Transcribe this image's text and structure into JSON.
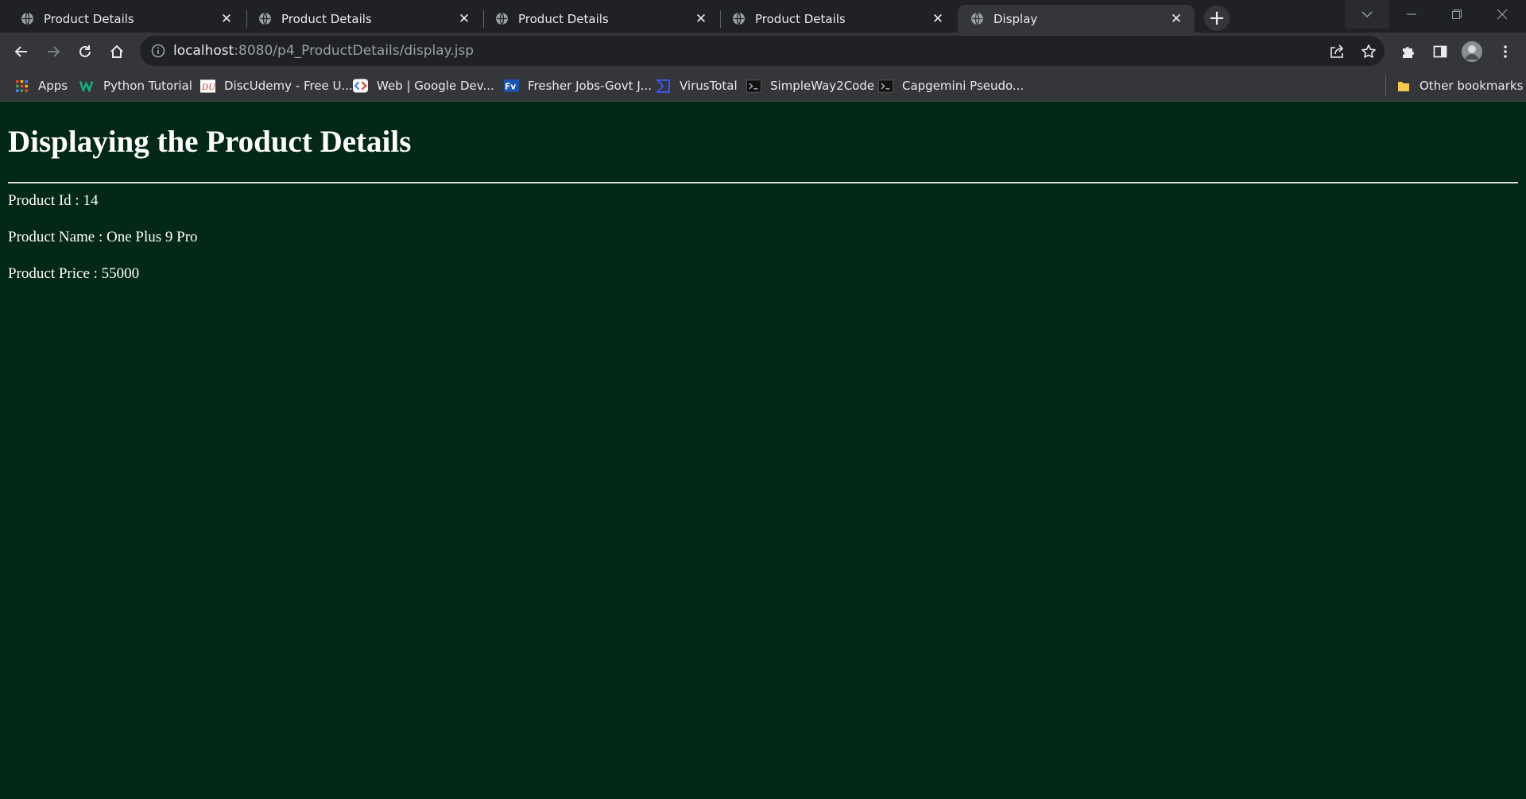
{
  "browser": {
    "tabs": [
      {
        "title": "Product Details"
      },
      {
        "title": "Product Details"
      },
      {
        "title": "Product Details"
      },
      {
        "title": "Product Details"
      },
      {
        "title": "Display",
        "active": true
      }
    ],
    "address": {
      "host": "localhost",
      "rest": ":8080/p4_ProductDetails/display.jsp"
    },
    "bookmarks": [
      {
        "label": "Apps",
        "icon": "apps-grid-icon"
      },
      {
        "label": "Python Tutorial",
        "icon": "w-logo-icon"
      },
      {
        "label": "DiscUdemy - Free U...",
        "icon": "discudemy-icon"
      },
      {
        "label": "Web  |  Google Dev...",
        "icon": "google-developers-icon"
      },
      {
        "label": "Fresher Jobs-Govt J...",
        "icon": "fv-logo-icon"
      },
      {
        "label": "VirusTotal",
        "icon": "virustotal-icon"
      },
      {
        "label": "SimpleWay2Code",
        "icon": "terminal-icon"
      },
      {
        "label": "Capgemini Pseudo...",
        "icon": "terminal-icon"
      }
    ],
    "other_bookmarks": "Other bookmarks",
    "colors": {
      "tabstrip": "#202124",
      "toolbar": "#35363a",
      "omnibox": "#202124",
      "page_background": "#032816",
      "text": "#e8eaed"
    }
  },
  "page": {
    "heading": "Displaying the Product Details",
    "id_line": "Product Id : 14",
    "name_line": "Product Name : One Plus 9 Pro",
    "price_line": "Product Price : 55000"
  }
}
